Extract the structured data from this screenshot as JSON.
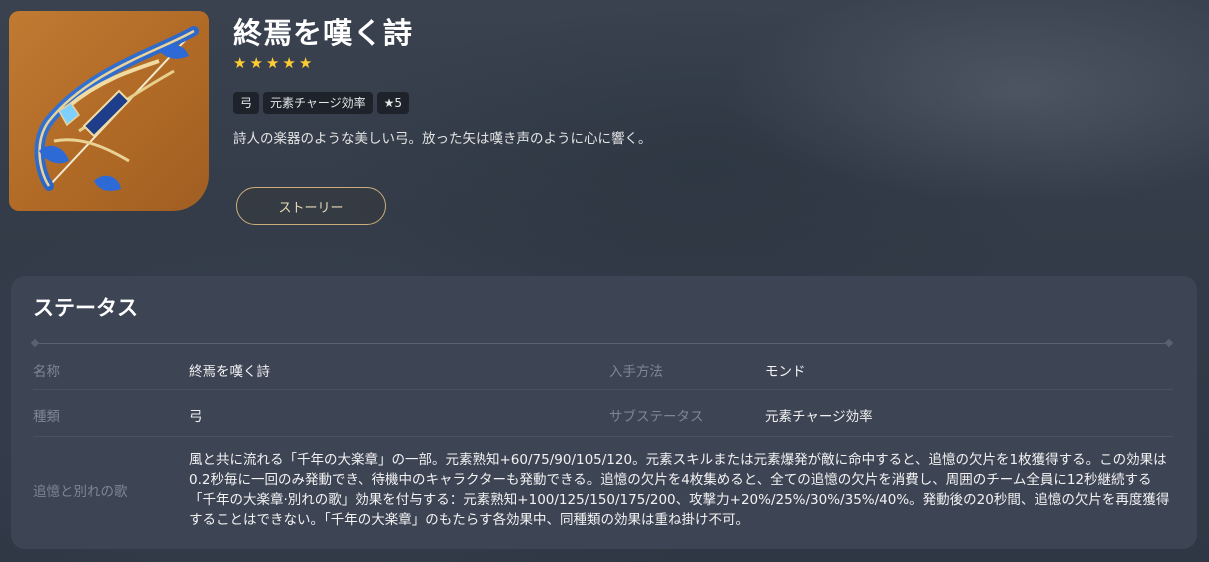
{
  "weapon": {
    "name": "終焉を嘆く詩",
    "rarity_stars": 5,
    "tags": [
      "弓",
      "元素チャージ効率",
      "★5"
    ],
    "description": "詩人の楽器のような美しい弓。放った矢は嘆き声のように心に響く。",
    "story_button_label": "ストーリー",
    "icon": "bow-icon"
  },
  "status": {
    "title": "ステータス",
    "name_label": "名称",
    "name_value": "終焉を嘆く詩",
    "source_label": "入手方法",
    "source_value": "モンド",
    "type_label": "種類",
    "type_value": "弓",
    "substat_label": "サブステータス",
    "substat_value": "元素チャージ効率",
    "passive_label": "追憶と別れの歌",
    "passive_value": "風と共に流れる「千年の大楽章」の一部。元素熟知+60/75/90/105/120。元素スキルまたは元素爆発が敵に命中すると、追憶の欠片を1枚獲得する。この効果は0.2秒毎に一回のみ発動でき、待機中のキャラクターも発動できる。追憶の欠片を4枚集めると、全ての追憶の欠片を消費し、周囲のチーム全員に12秒継続する「千年の大楽章·別れの歌」効果を付与する：元素熟知+100/125/150/175/200、攻撃力+20%/25%/30%/35%/40%。発動後の20秒間、追憶の欠片を再度獲得することはできない。「千年の大楽章」のもたらす各効果中、同種類の効果は重ね掛け不可。"
  },
  "colors": {
    "star": "#ffcc33",
    "icon_background": "#c17a32",
    "panel": "#3d4454",
    "button_border": "#c9ae7c"
  }
}
